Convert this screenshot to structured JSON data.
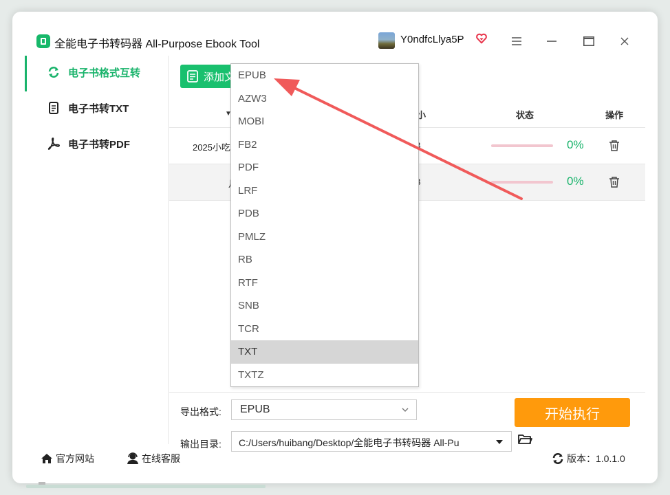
{
  "app": {
    "title": "全能电子书转码器 All-Purpose Ebook Tool"
  },
  "user": {
    "name": "Y0ndfcLlya5P"
  },
  "sidebar": {
    "items": [
      {
        "label": "电子书格式互转",
        "icon": "refresh-icon",
        "active": true
      },
      {
        "label": "电子书转TXT",
        "icon": "document-icon",
        "active": false
      },
      {
        "label": "电子书转PDF",
        "icon": "pdf-icon",
        "active": false
      }
    ]
  },
  "toolbar": {
    "add_label": "添加文"
  },
  "table": {
    "headers": {
      "sort_mark": "▼",
      "size": "小",
      "status": "状态",
      "action": "操作"
    },
    "rows": [
      {
        "name": "2025小吃",
        "size": "B",
        "progress_pct": "0%"
      },
      {
        "name": "月",
        "size": "B",
        "progress_pct": "0%"
      }
    ]
  },
  "format": {
    "label": "导出格式:",
    "selected": "EPUB",
    "options": [
      "EPUB",
      "AZW3",
      "MOBI",
      "FB2",
      "PDF",
      "LRF",
      "PDB",
      "PMLZ",
      "RB",
      "RTF",
      "SNB",
      "TCR",
      "TXT",
      "TXTZ"
    ],
    "highlighted": "TXT"
  },
  "output": {
    "label": "输出目录:",
    "path": "C:/Users/huibang/Desktop/全能电子书转码器 All-Pu"
  },
  "start_button": {
    "label": "开始执行"
  },
  "statusbar": {
    "website": "官方网站",
    "support": "在线客服",
    "version": "版本：1.0.1.0"
  },
  "colors": {
    "accent": "#19b36b",
    "start": "#ff9a0c",
    "annotation": "#f05a5a"
  }
}
